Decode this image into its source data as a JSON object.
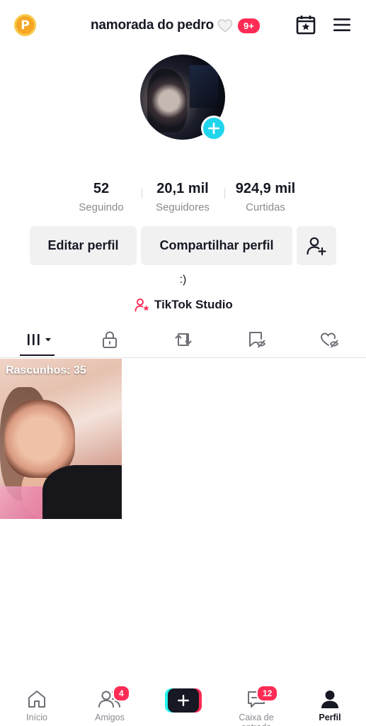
{
  "header": {
    "username": "namorada do pedro",
    "notification_badge": "9+",
    "coin_letter": "P",
    "icons": [
      "coin-icon",
      "heart-icon",
      "calendar-star-icon",
      "menu-icon"
    ]
  },
  "profile": {
    "avatar": "profile-photo",
    "bio": ":)",
    "studio_link": "TikTok Studio"
  },
  "stats": [
    {
      "value": "52",
      "label": "Seguindo"
    },
    {
      "value": "20,1 mil",
      "label": "Seguidores"
    },
    {
      "value": "924,9 mil",
      "label": "Curtidas"
    }
  ],
  "actions": {
    "edit": "Editar perfil",
    "share": "Compartilhar perfil",
    "add_friend_icon": "add-user-icon"
  },
  "tabs": [
    "videos-grid-icon",
    "lock-icon",
    "repost-icon",
    "saved-icon",
    "liked-icon"
  ],
  "grid": {
    "drafts_label": "Rascunhos: 35"
  },
  "nav": {
    "home": "Início",
    "friends": "Amigos",
    "friends_badge": "4",
    "inbox": "Caixa de entrada",
    "inbox_badge": "12",
    "profile": "Perfil"
  },
  "colors": {
    "accent_red": "#fe2c55",
    "accent_cyan": "#20d5ec",
    "text": "#161823",
    "muted": "#8a8b91",
    "button_bg": "#f1f1f2"
  }
}
